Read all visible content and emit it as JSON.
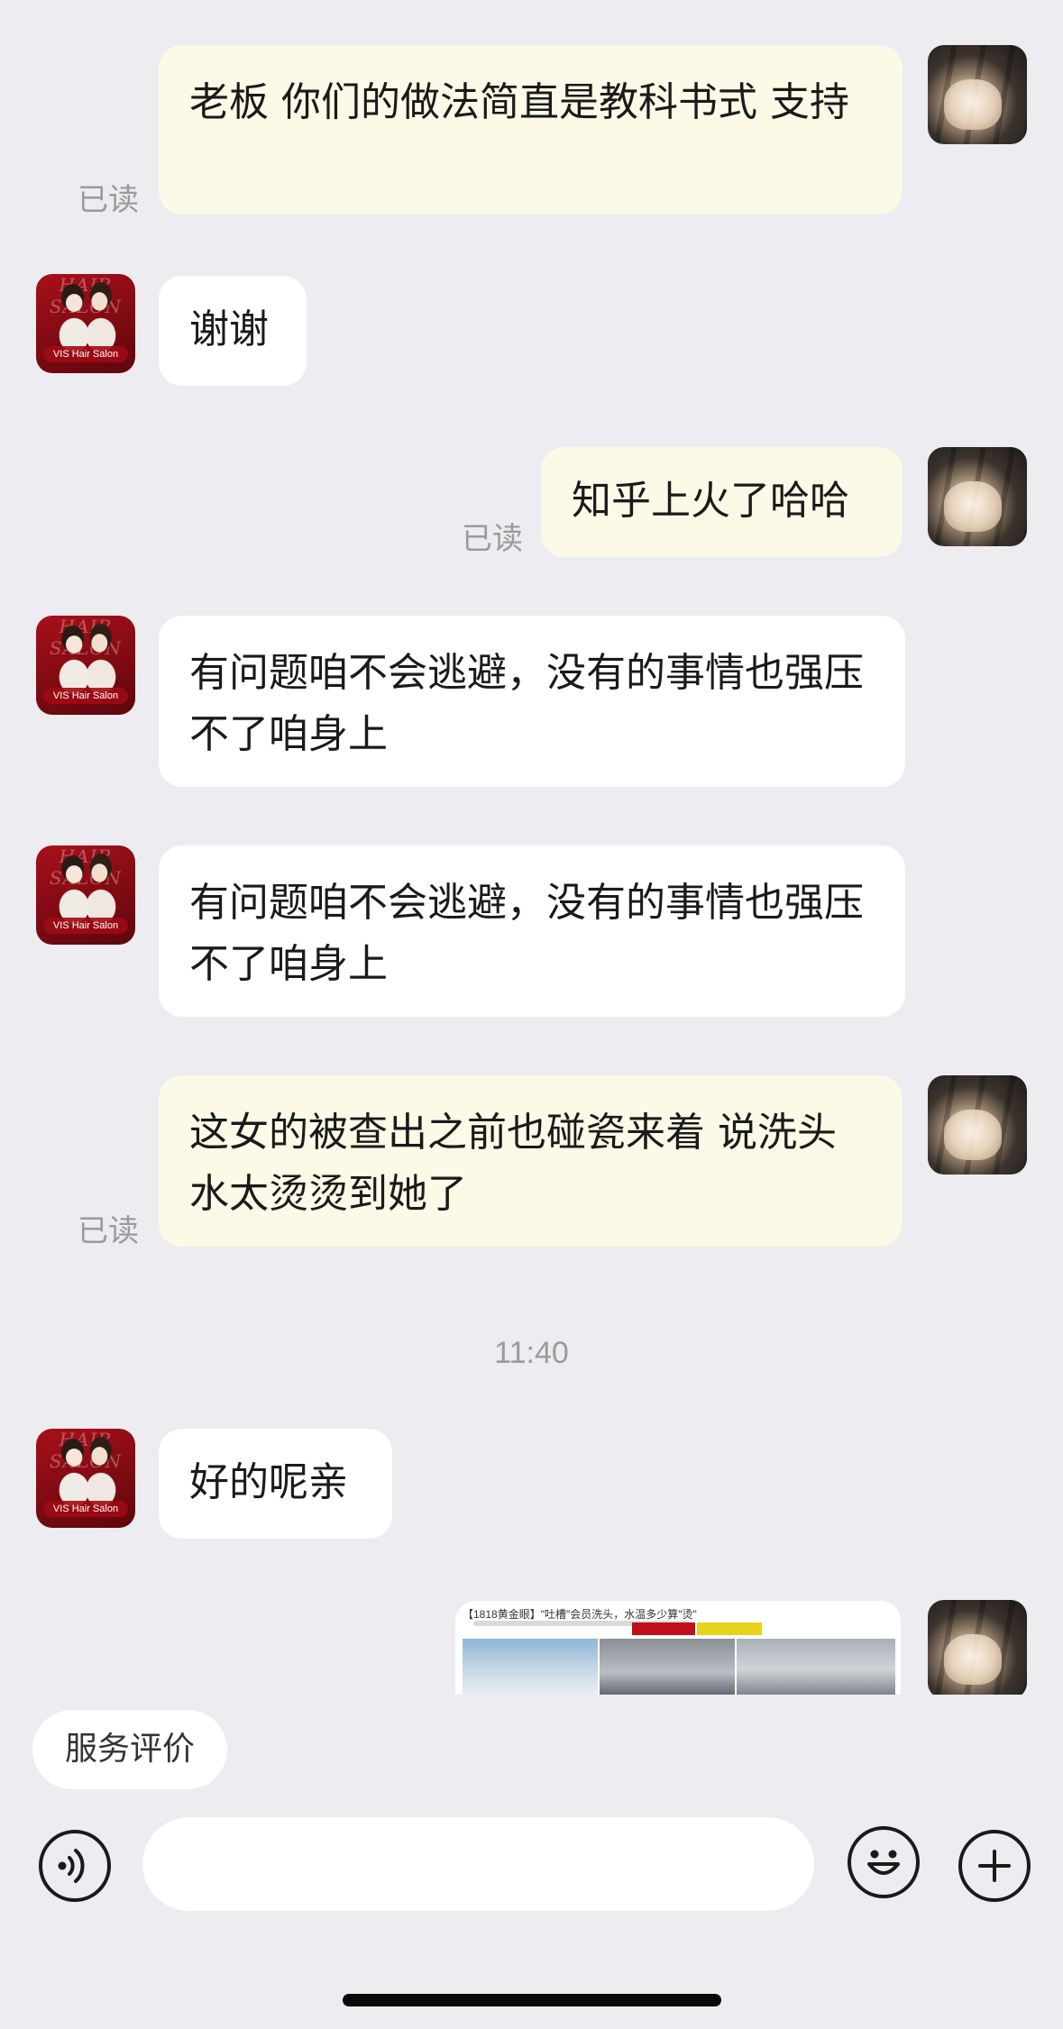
{
  "messages": [
    {
      "side": "me",
      "text": "老板 你们的做法简直是教科书式 支持",
      "read": "已读"
    },
    {
      "side": "them",
      "text": "谢谢"
    },
    {
      "side": "me",
      "text": "知乎上火了哈哈",
      "read": "已读"
    },
    {
      "side": "them",
      "text": "有问题咱不会逃避，没有的事情也强压不了咱身上"
    },
    {
      "side": "them",
      "text": "有问题咱不会逃避，没有的事情也强压不了咱身上"
    },
    {
      "side": "me",
      "text": "这女的被查出之前也碰瓷来着 说洗头水太烫烫到她了",
      "read": "已读"
    },
    {
      "side": "them",
      "text": "好的呢亲"
    },
    {
      "side": "me",
      "type": "image"
    }
  ],
  "timestamp": "11:40",
  "shop_avatar_label": "VIS Hair Salon",
  "shop_avatar_top_text": "HAIR SALON",
  "image_preview": {
    "caption": "【1818黄金眼】\"吐槽\"会员洗头，水温多少算\"烫\""
  },
  "quick_actions": {
    "service_rating": "服务评价"
  },
  "input": {
    "placeholder": "",
    "value": ""
  },
  "icons": [
    "voice-icon",
    "emoji-icon",
    "plus-icon"
  ],
  "colors": {
    "background": "#ECECF1",
    "my_bubble": "#FCF9E7",
    "their_bubble": "#FFFFFF",
    "read_text": "#9B9B9B"
  }
}
